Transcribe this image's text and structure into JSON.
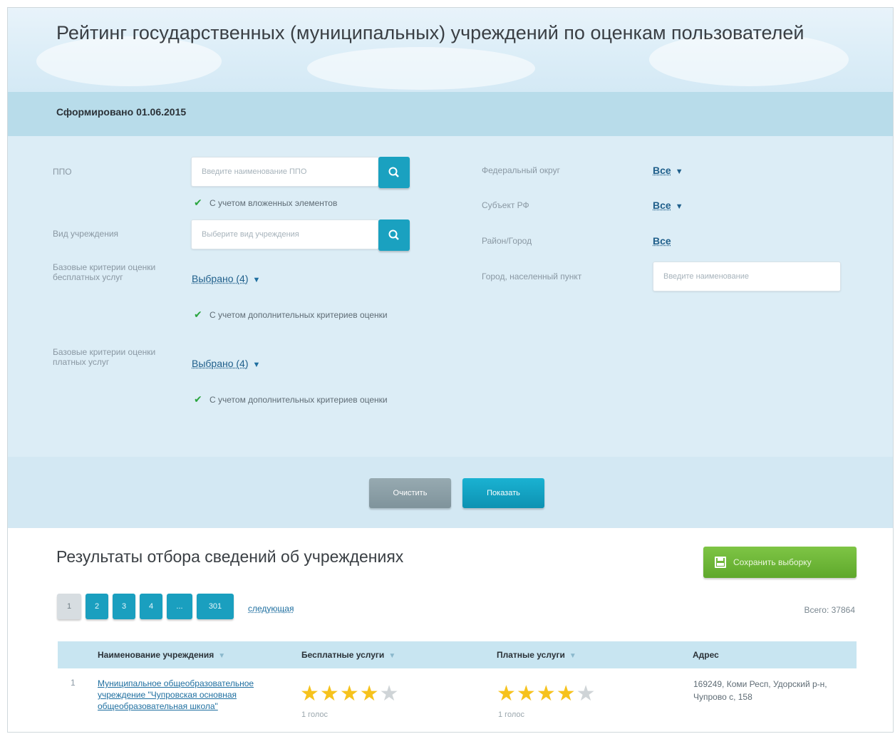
{
  "page": {
    "title": "Рейтинг государственных (муниципальных) учреждений по оценкам пользователей",
    "formed": "Сформировано 01.06.2015"
  },
  "filters": {
    "ppo": {
      "label": "ППО",
      "placeholder": "Введите наименование ППО",
      "checkbox": "С учетом вложенных элементов"
    },
    "type": {
      "label": "Вид учреждения",
      "placeholder": "Выберите вид учреждения"
    },
    "free_criteria": {
      "label": "Базовые критерии оценки бесплатных услуг",
      "value": "Выбрано (4)",
      "checkbox": "С учетом дополнительных критериев оценки"
    },
    "paid_criteria": {
      "label": "Базовые критерии оценки платных услуг",
      "value": "Выбрано (4)",
      "checkbox": "С учетом дополнительных критериев оценки"
    },
    "federal_district": {
      "label": "Федеральный округ",
      "value": "Все"
    },
    "subject": {
      "label": "Субъект РФ",
      "value": "Все"
    },
    "district": {
      "label": "Район/Город",
      "value": "Все"
    },
    "city": {
      "label": "Город, населенный пункт",
      "placeholder": "Введите наименование"
    }
  },
  "actions": {
    "clear": "Очистить",
    "show": "Показать"
  },
  "results": {
    "title": "Результаты отбора сведений об учреждениях",
    "save": "Сохранить выборку",
    "pages": [
      "1",
      "2",
      "3",
      "4",
      "...",
      "301"
    ],
    "next": "следующая",
    "total": "Всего: 37864",
    "columns": [
      "Наименование учреждения",
      "Бесплатные услуги",
      "Платные услуги",
      "Адрес"
    ],
    "rows": [
      {
        "num": "1",
        "name": "Муниципальное общеобразовательное учреждение \"Чупровская основная общеобразовательная школа\"",
        "free_rating": 4,
        "free_votes": "1 голос",
        "paid_rating": 4,
        "paid_votes": "1 голос",
        "address": "169249, Коми Респ, Удорский р-н, Чупрово с, 158"
      }
    ]
  },
  "colors": {
    "accent": "#1aa1c0",
    "save": "#6ab63a",
    "star": "#f6c21c"
  }
}
